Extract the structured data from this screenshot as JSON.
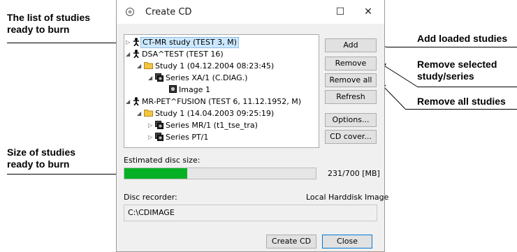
{
  "callouts": {
    "list_line1": "The list of studies",
    "list_line2": "ready to burn",
    "size_line1": "Size of studies",
    "size_line2": "ready to burn",
    "add": "Add loaded studies",
    "remove_line1": "Remove selected",
    "remove_line2": "study/series",
    "remove_all": "Remove all studies"
  },
  "dialog": {
    "title": "Create CD",
    "maximize_glyph": "☐",
    "close_glyph": "✕",
    "tree": [
      {
        "label": "CT-MR study (TEST 3, M)",
        "icon": "patient-icon",
        "expander": "▷",
        "selected": true
      },
      {
        "label": "DSA^TEST (TEST 16)",
        "icon": "patient-icon",
        "expander": "◢"
      },
      {
        "label": "Study 1 (04.12.2004 08:23:45)",
        "icon": "folder-icon",
        "expander": "◢"
      },
      {
        "label": "Series XA/1 (C.DIAG.)",
        "icon": "series-icon",
        "expander": "◢"
      },
      {
        "label": "Image 1",
        "icon": "image-icon",
        "expander": ""
      },
      {
        "label": "MR-PET^FUSION (TEST 6, 11.12.1952, M)",
        "icon": "patient-icon",
        "expander": "◢"
      },
      {
        "label": "Study 1 (14.04.2003 09:25:19)",
        "icon": "folder-icon",
        "expander": "◢"
      },
      {
        "label": "Series MR/1 (t1_tse_tra)",
        "icon": "series-icon",
        "expander": "▷"
      },
      {
        "label": "Series PT/1",
        "icon": "series-icon",
        "expander": "▷"
      }
    ],
    "buttons": {
      "add": "Add",
      "remove": "Remove",
      "remove_all": "Remove all",
      "refresh": "Refresh",
      "options": "Options...",
      "cd_cover": "CD cover..."
    },
    "disc_size_label": "Estimated disc size:",
    "disc_size_fraction": 0.33,
    "disc_size_value": "231/700 [MB]",
    "disc_recorder_label": "Disc recorder:",
    "disc_recorder_value": "Local Harddisk Image",
    "path_value": "C:\\CDIMAGE",
    "create_button": "Create CD",
    "close_button": "Close"
  },
  "colors": {
    "progress_fill": "#06b025",
    "selection": "#cce8ff"
  }
}
